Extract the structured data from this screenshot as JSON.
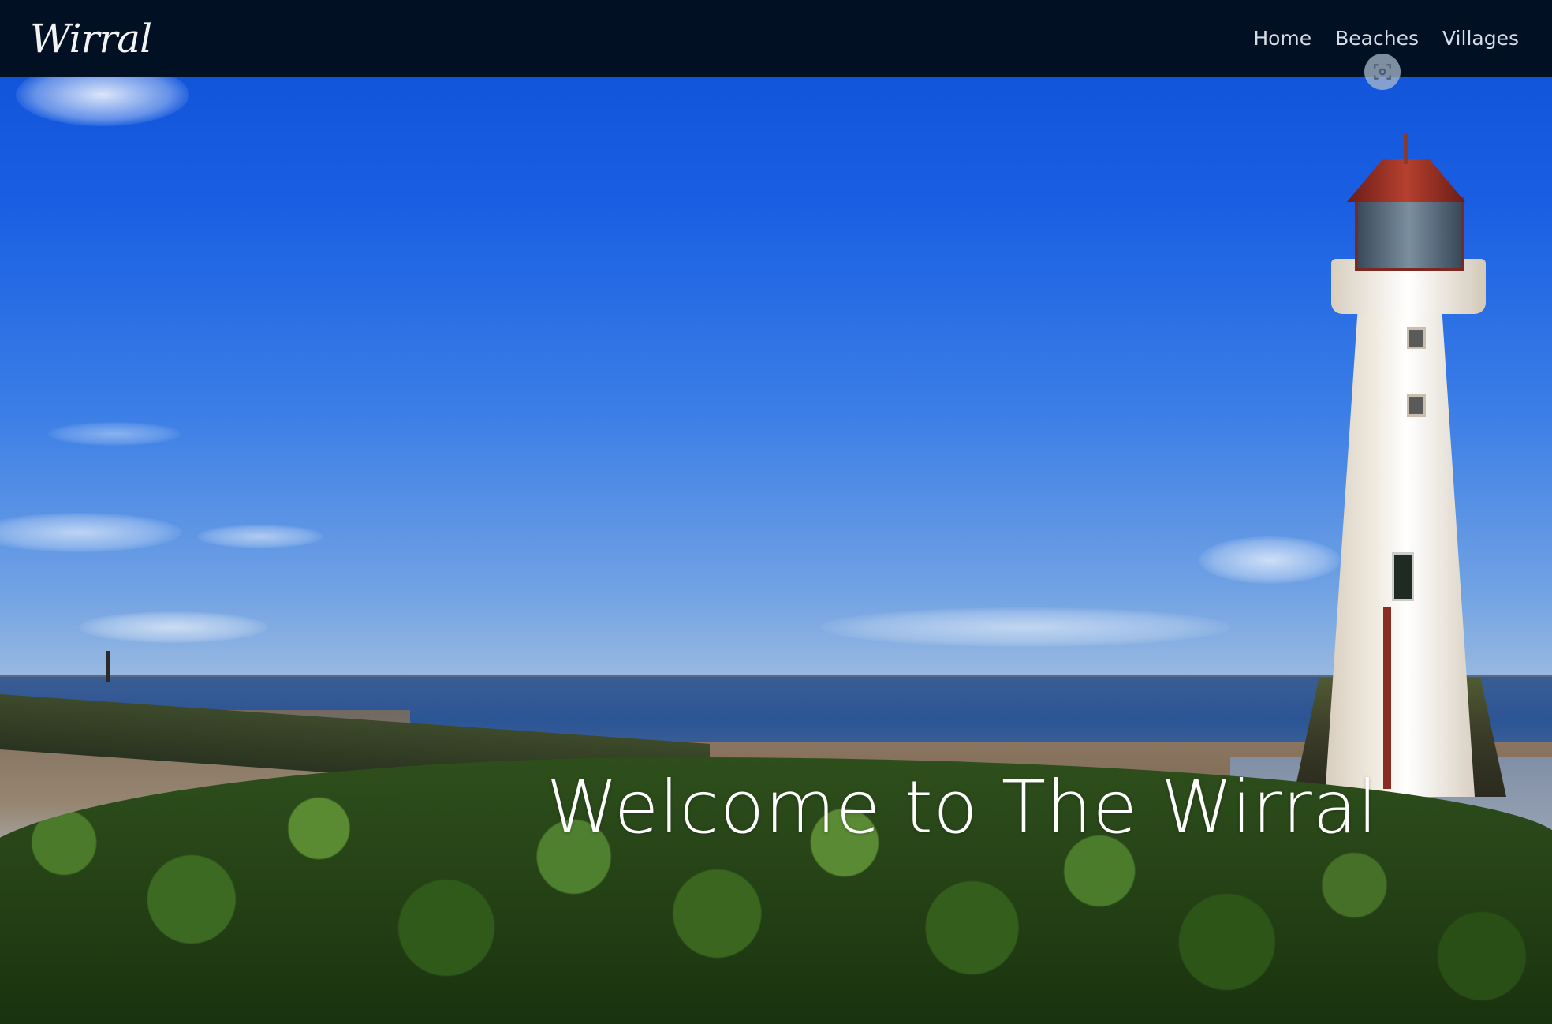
{
  "navbar": {
    "brand": "Wirral",
    "links": [
      {
        "label": "Home"
      },
      {
        "label": "Beaches"
      },
      {
        "label": "Villages"
      }
    ],
    "background": "#011023"
  },
  "hero": {
    "headline": "Welcome to The Wirral",
    "image_subject": "lighthouse-on-beach-with-rock-breakwater"
  },
  "floating_button": {
    "icon": "screenshot-capture-icon"
  }
}
